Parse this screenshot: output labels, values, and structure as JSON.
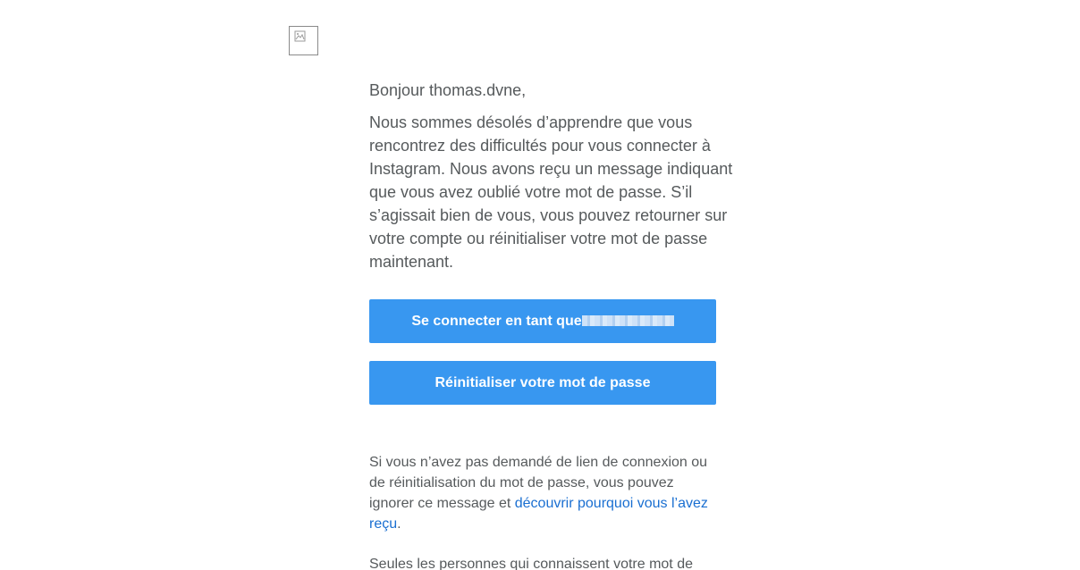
{
  "email": {
    "greeting": "Bonjour thomas.dvne,",
    "body": "Nous sommes désolés d’apprendre que vous rencontrez des difficultés pour vous connecter à Instagram. Nous avons reçu un message indiquant que vous avez oublié votre mot de passe. S’il s’agissait bien de vous, vous pouvez retourner sur votre compte ou réinitialiser votre mot de passe maintenant.",
    "login_button_label": "Se connecter en tant que",
    "reset_button_label": "Réinitialiser votre mot de passe",
    "footer_text_before_link": "Si vous n’avez pas demandé de lien de connexion ou de réinitialisation du mot de passe, vous pouvez ignorer ce message et ",
    "footer_link": "découvrir pourquoi vous l’avez reçu",
    "footer_text_after_link": ".",
    "second_paragraph_partial": "Seules les personnes qui connaissent votre mot de"
  },
  "colors": {
    "button": "#3897f0",
    "text": "#565a5c",
    "link": "#1a6fd1"
  },
  "icons": {
    "logo": "broken-image-icon"
  }
}
